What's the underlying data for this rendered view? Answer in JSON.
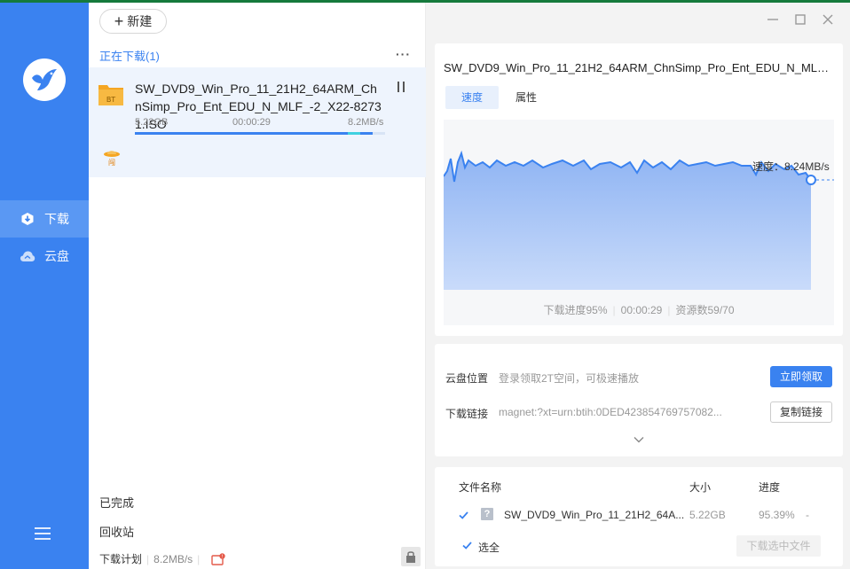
{
  "sidebar": {
    "items": [
      {
        "label": "下载",
        "icon": "download-icon",
        "active": true
      },
      {
        "label": "云盘",
        "icon": "cloud-icon",
        "active": false
      }
    ],
    "menu_icon": "hamburger-icon"
  },
  "toolbar": {
    "new_label": "新建"
  },
  "list": {
    "section_title": "正在下载(1)",
    "task": {
      "name": "SW_DVD9_Win_Pro_11_21H2_64ARM_ChnSimp_Pro_Ent_EDU_N_MLF_-2_X22-82731.ISO",
      "file_badge": "BT",
      "size": "5.22GB",
      "time": "00:00:29",
      "speed": "8.2MB/s",
      "progress": 0.95
    },
    "completed_label": "已完成",
    "recycle_label": "回收站",
    "plan_label": "下载计划",
    "plan_speed": "8.2MB/s"
  },
  "detail": {
    "title": "SW_DVD9_Win_Pro_11_21H2_64ARM_ChnSimp_Pro_Ent_EDU_N_MLF_-2_X22-82731.ISO",
    "tabs": [
      {
        "label": "速度"
      },
      {
        "label": "属性"
      }
    ],
    "speed_label": "速度：8.24MB/s",
    "stats": {
      "progress": "下载进度95%",
      "time": "00:00:29",
      "sources": "资源数59/70"
    },
    "cloud": {
      "label": "云盘位置",
      "value": "登录领取2T空间，可极速播放",
      "button": "立即领取"
    },
    "link": {
      "label": "下载链接",
      "value": "magnet:?xt=urn:btih:0DED423854769757082...",
      "button": "复制链接"
    },
    "files": {
      "col_name": "文件名称",
      "col_size": "大小",
      "col_progress": "进度",
      "rows": [
        {
          "name": "SW_DVD9_Win_Pro_11_21H2_64A...",
          "size": "5.22GB",
          "progress": "95.39%",
          "extra": "-"
        }
      ],
      "select_all": "选全",
      "download_selected": "下载选中文件"
    }
  },
  "colors": {
    "accent": "#3a82f0",
    "sidebar": "#3a82f0",
    "chart_fill": "#a9c6f7"
  }
}
